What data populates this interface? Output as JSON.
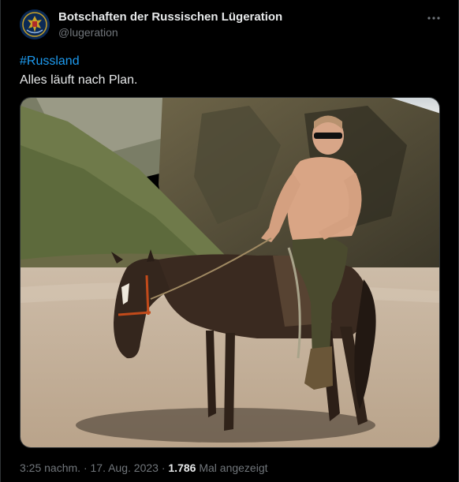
{
  "author": {
    "name": "Botschaften der Russischen Lügeration",
    "handle": "@lugeration"
  },
  "tweet": {
    "hashtag": "#Russland",
    "text": "Alles läuft nach Plan.",
    "media_alt": "Shirtless man in sunglasses riding an emaciated brown horse in a rocky landscape"
  },
  "meta": {
    "time": "3:25 nachm.",
    "separator": "·",
    "date": "17. Aug. 2023",
    "views_count": "1.786",
    "views_label": "Mal angezeigt"
  },
  "icons": {
    "avatar": "embassy-emblem",
    "more": "more-horizontal-icon"
  },
  "colors": {
    "background": "#000000",
    "text": "#e7e9ea",
    "secondary": "#71767b",
    "link": "#1d9bf0",
    "border": "#2f3336"
  }
}
